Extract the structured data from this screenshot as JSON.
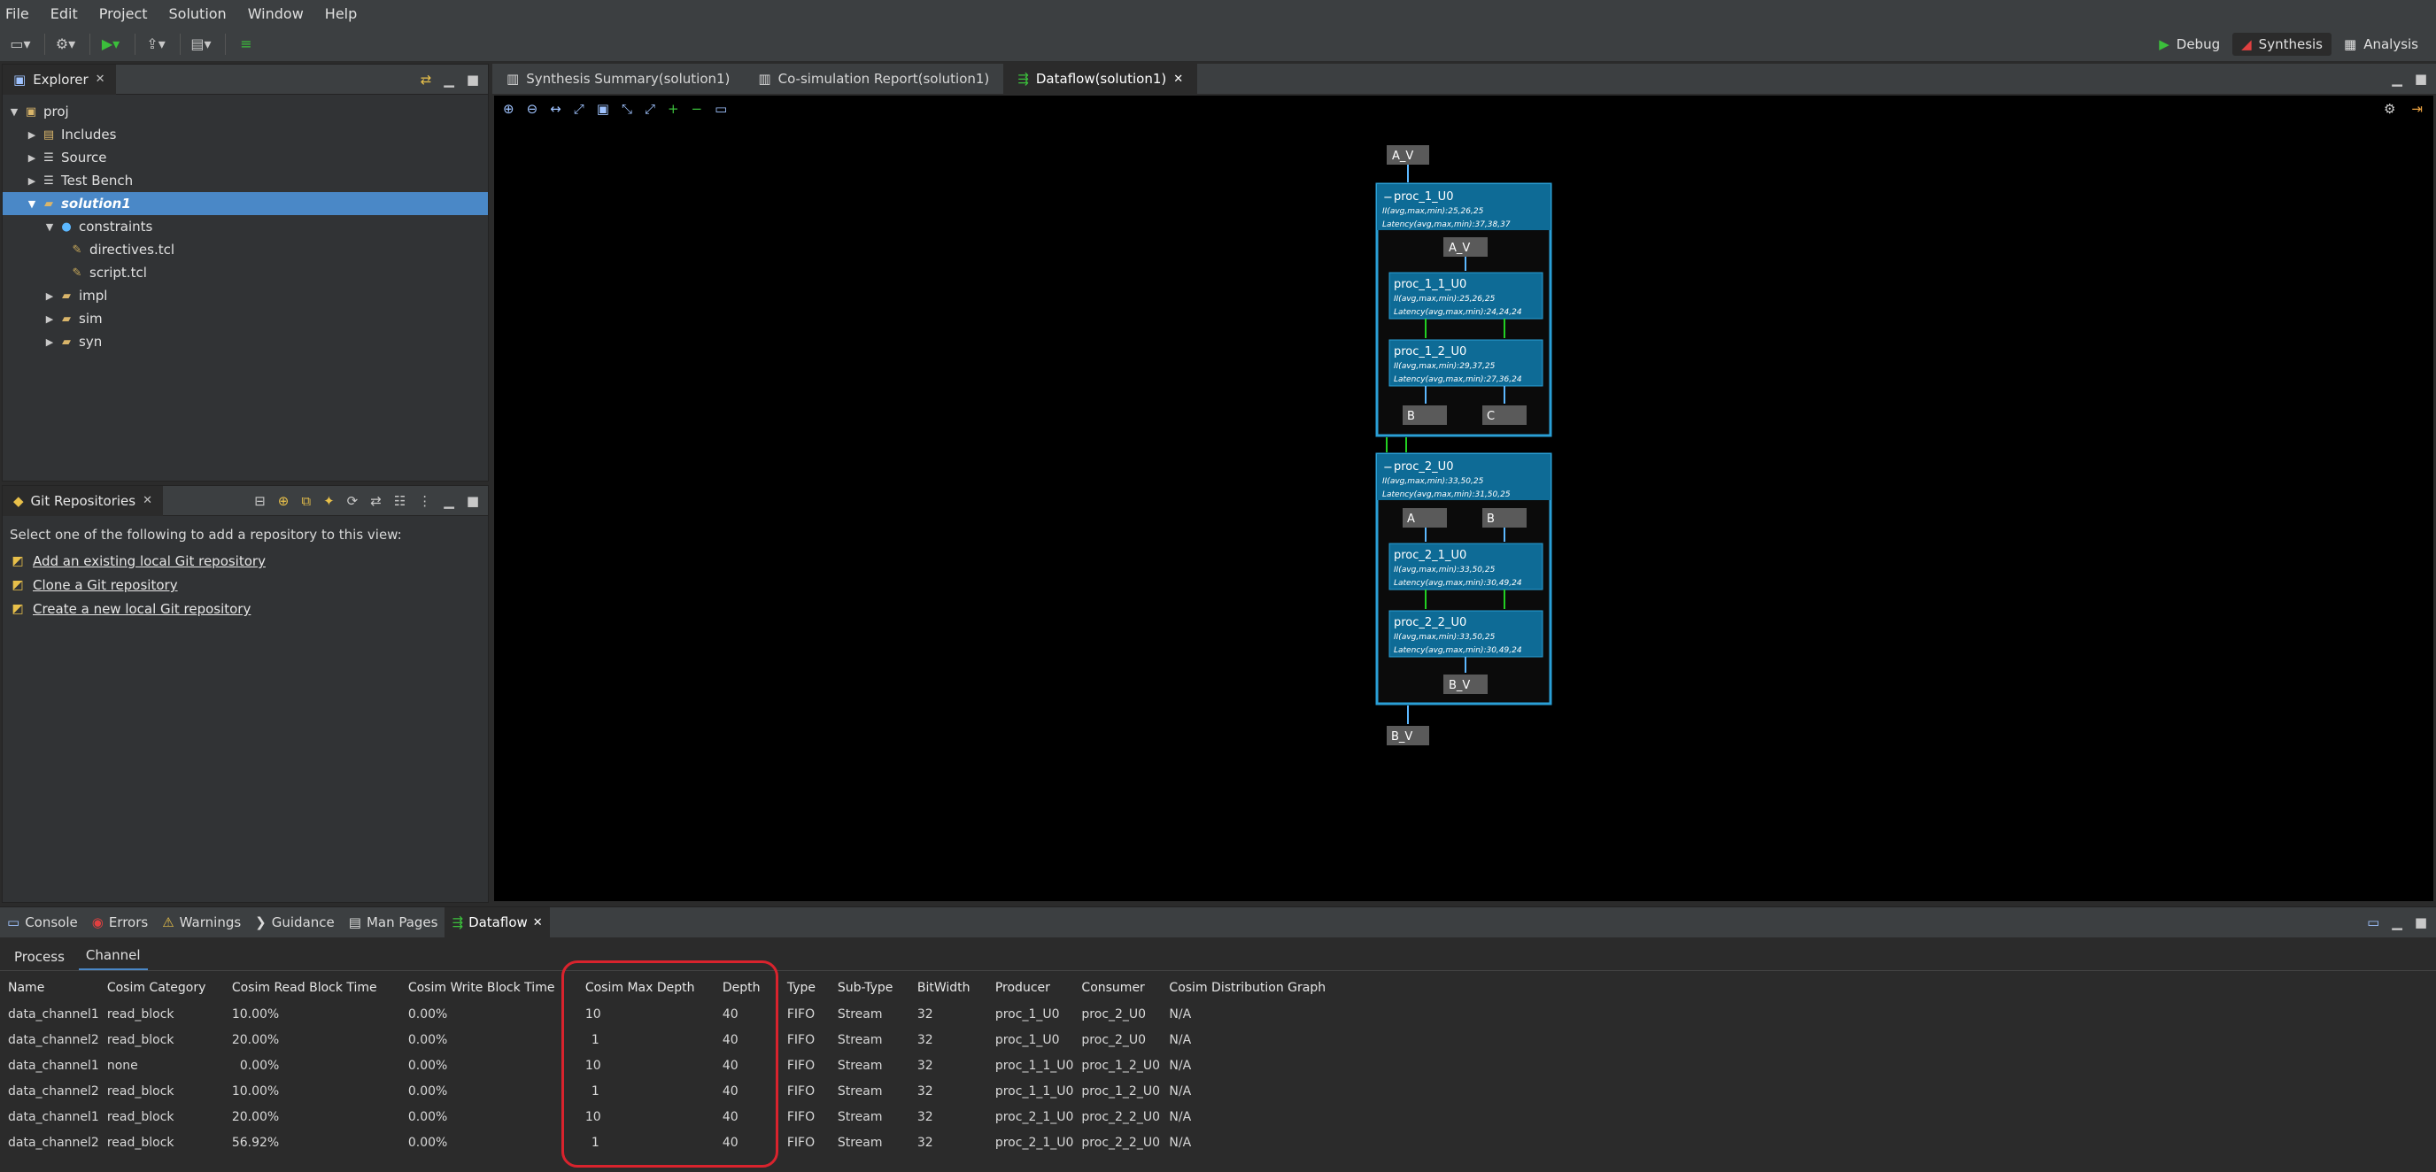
{
  "menu": [
    "File",
    "Edit",
    "Project",
    "Solution",
    "Window",
    "Help"
  ],
  "perspectives": {
    "debug": "Debug",
    "synthesis": "Synthesis",
    "analysis": "Analysis"
  },
  "explorer": {
    "title": "Explorer",
    "tree": {
      "root": "proj",
      "includes": "Includes",
      "source": "Source",
      "testbench": "Test Bench",
      "solution": "solution1",
      "constraints": "constraints",
      "directives": "directives.tcl",
      "script": "script.tcl",
      "impl": "impl",
      "sim": "sim",
      "syn": "syn"
    }
  },
  "git": {
    "title": "Git Repositories",
    "intro": "Select one of the following to add a repository to this view:",
    "links": [
      "Add an existing local Git repository",
      "Clone a Git repository",
      "Create a new local Git repository"
    ]
  },
  "editor": {
    "tabs": [
      "Synthesis Summary(solution1)",
      "Co-simulation Report(solution1)",
      "Dataflow(solution1)"
    ]
  },
  "graph": {
    "ports": {
      "a_v": "A_V",
      "b_v": "B_V",
      "b": "B",
      "c": "C",
      "a": "A"
    },
    "proc1": {
      "name": "proc_1_U0",
      "ii": "II(avg,max,min):25,26,25",
      "latency": "Latency(avg,max,min):37,38,37"
    },
    "proc1_1": {
      "name": "proc_1_1_U0",
      "ii": "II(avg,max,min):25,26,25",
      "latency": "Latency(avg,max,min):24,24,24"
    },
    "proc1_2": {
      "name": "proc_1_2_U0",
      "ii": "II(avg,max,min):29,37,25",
      "latency": "Latency(avg,max,min):27,36,24"
    },
    "proc2": {
      "name": "proc_2_U0",
      "ii": "II(avg,max,min):33,50,25",
      "latency": "Latency(avg,max,min):31,50,25"
    },
    "proc2_1": {
      "name": "proc_2_1_U0",
      "ii": "II(avg,max,min):33,50,25",
      "latency": "Latency(avg,max,min):30,49,24"
    },
    "proc2_2": {
      "name": "proc_2_2_U0",
      "ii": "II(avg,max,min):33,50,25",
      "latency": "Latency(avg,max,min):30,49,24"
    }
  },
  "bottom": {
    "tabs": [
      "Console",
      "Errors",
      "Warnings",
      "Guidance",
      "Man Pages",
      "Dataflow"
    ],
    "subtabs": [
      "Process",
      "Channel"
    ],
    "columns": [
      "Name",
      "Cosim Category",
      "Cosim Read Block Time",
      "Cosim Write Block Time",
      "Cosim Max Depth",
      "Depth",
      "Type",
      "Sub-Type",
      "BitWidth",
      "Producer",
      "Consumer",
      "Cosim Distribution Graph"
    ],
    "rows": [
      [
        "data_channel1",
        "read_block",
        "10.00%",
        "0.00%",
        "10",
        "40",
        "FIFO",
        "Stream",
        "32",
        "proc_1_U0",
        "proc_2_U0",
        "N/A"
      ],
      [
        "data_channel2",
        "read_block",
        "20.00%",
        "0.00%",
        "1",
        "40",
        "FIFO",
        "Stream",
        "32",
        "proc_1_U0",
        "proc_2_U0",
        "N/A"
      ],
      [
        "data_channel1",
        "none",
        "0.00%",
        "0.00%",
        "10",
        "40",
        "FIFO",
        "Stream",
        "32",
        "proc_1_1_U0",
        "proc_1_2_U0",
        "N/A"
      ],
      [
        "data_channel2",
        "read_block",
        "10.00%",
        "0.00%",
        "1",
        "40",
        "FIFO",
        "Stream",
        "32",
        "proc_1_1_U0",
        "proc_1_2_U0",
        "N/A"
      ],
      [
        "data_channel1",
        "read_block",
        "20.00%",
        "0.00%",
        "10",
        "40",
        "FIFO",
        "Stream",
        "32",
        "proc_2_1_U0",
        "proc_2_2_U0",
        "N/A"
      ],
      [
        "data_channel2",
        "read_block",
        "56.92%",
        "0.00%",
        "1",
        "40",
        "FIFO",
        "Stream",
        "32",
        "proc_2_1_U0",
        "proc_2_2_U0",
        "N/A"
      ]
    ]
  },
  "colors": {
    "block": "#0e6b96",
    "block_border": "#2a9fd6",
    "port": "#5a5a5a",
    "edge_blue": "#5cb8ff",
    "edge_green": "#22d022",
    "selection": "#4a88c7",
    "highlight": "#d9232d"
  },
  "icons": [
    "folder-icon",
    "file-icon",
    "zoom-in-icon",
    "zoom-out-icon",
    "close-icon",
    "minimize-icon",
    "maximize-icon",
    "git-icon",
    "gear-icon"
  ]
}
